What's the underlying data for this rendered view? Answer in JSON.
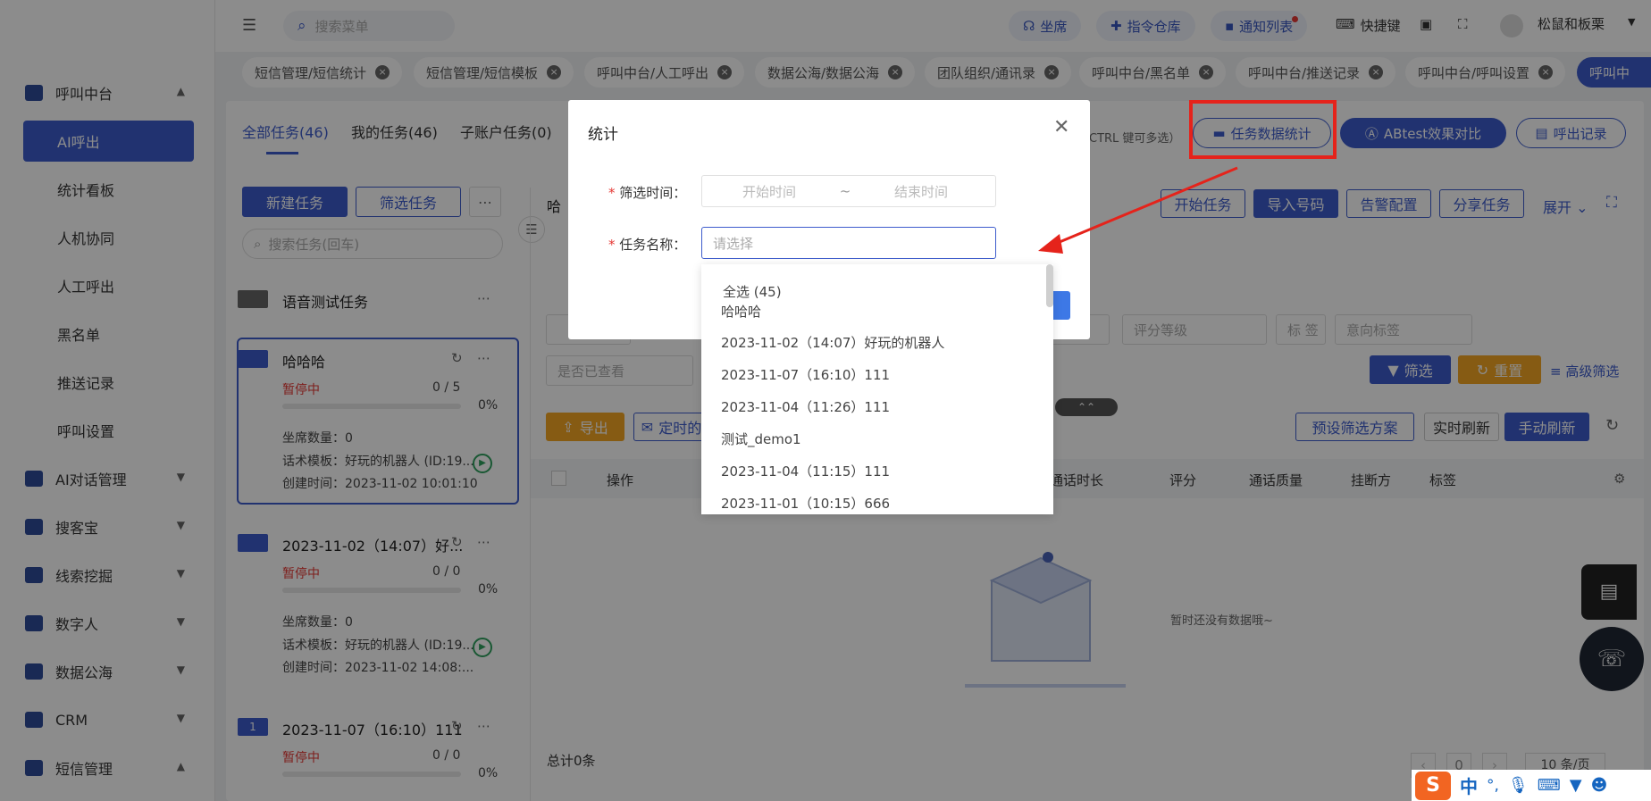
{
  "sidebar": {
    "items": [
      {
        "label": "呼叫中台",
        "expanded": true
      },
      {
        "label": "AI对话管理"
      },
      {
        "label": "搜客宝"
      },
      {
        "label": "线索挖掘"
      },
      {
        "label": "数字人"
      },
      {
        "label": "数据公海"
      },
      {
        "label": "CRM"
      },
      {
        "label": "短信管理",
        "expanded": true
      }
    ],
    "sub_items": [
      "AI呼出",
      "统计看板",
      "人机协同",
      "人工呼出",
      "黑名单",
      "推送记录",
      "呼叫设置"
    ]
  },
  "header": {
    "search_placeholder": "搜索菜单",
    "pills": [
      "坐席",
      "指令仓库",
      "通知列表"
    ],
    "shortcut": "快捷键",
    "user": "松鼠和板栗"
  },
  "tabs": [
    "短信管理/短信统计",
    "短信管理/短信模板",
    "呼叫中台/人工呼出",
    "数据公海/数据公海",
    "团队组织/通讯录",
    "呼叫中台/黑名单",
    "呼叫中台/推送记录",
    "呼叫中台/呼叫设置",
    "呼叫中"
  ],
  "task_tabs": [
    "全部任务(46)",
    "我的任务(46)",
    "子账户任务(0)"
  ],
  "ctrl_hint": "CTRL 键可多选）",
  "top_buttons": {
    "stats": "任务数据统计",
    "abtest": "ABtest效果对比",
    "records": "呼出记录"
  },
  "left_panel": {
    "new_task": "新建任务",
    "filter_task": "筛选任务",
    "search_placeholder": "搜索任务(回车)",
    "voice_test": "语音测试任务",
    "cards": [
      {
        "title": "哈哈哈",
        "status": "暂停中",
        "count": "0 / 5",
        "percent": "0%",
        "seats": "坐席数量：0",
        "template": "话术模板：好玩的机器人 (ID:19...",
        "created": "创建时间：2023-11-02 10:01:10"
      },
      {
        "title": "2023-11-02（14:07）好...",
        "status": "暂停中",
        "count": "0 / 0",
        "percent": "0%",
        "seats": "坐席数量：0",
        "template": "话术模板：好玩的机器人 (ID:19...",
        "created": "创建时间：2023-11-02 14:08:..."
      },
      {
        "title": "2023-11-07（16:10）111",
        "status": "暂停中",
        "count": "0 / 0",
        "percent": "0%",
        "badge": "1"
      }
    ]
  },
  "right_panel": {
    "header_partial": "哈",
    "actions": [
      "开始任务",
      "导入号码",
      "告警配置",
      "分享任务"
    ],
    "expand": "展开",
    "filters": {
      "score_level": "评分等级",
      "tag": "标 签",
      "intent_tag": "意向标签",
      "viewed": "是否已查看"
    },
    "filter_btn": "筛选",
    "reset_btn": "重置",
    "advanced": "高级筛选",
    "export": "导出",
    "timed": "定时的",
    "preset": "预设筛选方案",
    "realtime": "实时刷新",
    "manual": "手动刷新",
    "columns": [
      "操作",
      "通话时长",
      "评分",
      "通话质量",
      "挂断方",
      "标签"
    ],
    "empty": "暂时还没有数据哦~",
    "total": "总计0条",
    "page": "0",
    "page_size": "10 条/页"
  },
  "modal": {
    "title": "统计",
    "time_label": "筛选时间：",
    "start_placeholder": "开始时间",
    "sep": "~",
    "end_placeholder": "结束时间",
    "name_label": "任务名称：",
    "name_placeholder": "请选择"
  },
  "dropdown": {
    "select_all": "全选 (45)",
    "options": [
      "哈哈哈",
      "2023-11-02（14:07）好玩的机器人",
      "2023-11-07（16:10）111",
      "2023-11-04（11:26）111",
      "测试_demo1",
      "2023-11-04（11:15）111",
      "2023-11-01（10:15）666"
    ]
  },
  "ime": {
    "lang": "中",
    "punct": "°,"
  },
  "colors": {
    "primary": "#3d5ccc",
    "highlight": "#e5231b",
    "warning": "#f5a623",
    "paused": "#e53935"
  }
}
